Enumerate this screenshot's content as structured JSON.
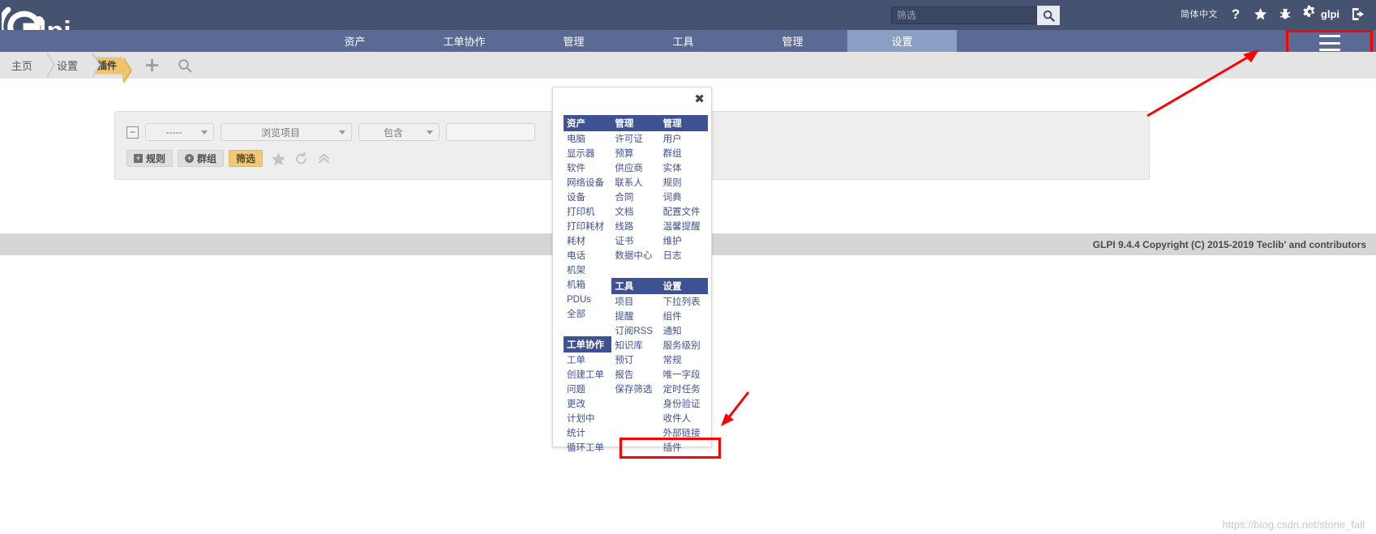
{
  "header": {
    "logo_text": "glpi",
    "search": {
      "placeholder": "筛选",
      "value": "",
      "icon": "search-icon"
    },
    "language": "简体中文",
    "help_icon": "question-mark-icon",
    "favorites_icon": "star-icon",
    "bug_icon": "bug-icon",
    "settings_icon": "gear-icon",
    "user_name": "glpi",
    "logout_icon": "logout-icon",
    "menu_toggle_icon": "hamburger-menu-icon"
  },
  "mainnav": {
    "items": [
      {
        "label": "资产",
        "active": false
      },
      {
        "label": "工单协作",
        "active": false
      },
      {
        "label": "管理",
        "active": false
      },
      {
        "label": "工具",
        "active": false
      },
      {
        "label": "管理",
        "active": false
      },
      {
        "label": "设置",
        "active": true
      }
    ]
  },
  "breadcrumb": {
    "items": [
      {
        "label": "主页",
        "selected": false
      },
      {
        "label": "设置",
        "selected": false
      },
      {
        "label": "插件",
        "selected": true
      }
    ],
    "tools": [
      {
        "name": "add-icon",
        "glyph": "+"
      },
      {
        "name": "search-icon",
        "glyph": "search"
      }
    ]
  },
  "filter_card": {
    "collapse_glyph": "−",
    "selects": [
      {
        "name": "logic-select",
        "value": "-----"
      },
      {
        "name": "field-select",
        "value": "浏览项目"
      },
      {
        "name": "operator-select",
        "value": "包含"
      }
    ],
    "text_value": "",
    "buttons": [
      {
        "name": "rule-button",
        "label": "规则",
        "icon": "plus-square-icon",
        "style": "grey"
      },
      {
        "name": "group-button",
        "label": "群组",
        "icon": "plus-circle-icon",
        "style": "grey"
      },
      {
        "name": "filter-button",
        "label": "筛选",
        "icon": "",
        "style": "amber"
      }
    ],
    "mini_tools": [
      {
        "name": "favorite-star-icon"
      },
      {
        "name": "reset-icon"
      },
      {
        "name": "collapse-chevron-icon"
      }
    ]
  },
  "footer": {
    "copyright": "GLPI 9.4.4 Copyright (C) 2015-2019 Teclib' and contributors"
  },
  "watermark": "https://blog.csdn.net/stone_fall",
  "mega_menu": {
    "close_glyph": "✖",
    "columns": [
      {
        "name": "column-assets-tickets",
        "groups": [
          {
            "header": "资产",
            "items": [
              "电脑",
              "显示器",
              "软件",
              "网络设备",
              "设备",
              "打印机",
              "打印耗材",
              "耗材",
              "电话",
              "机架",
              "机箱",
              "PDUs",
              "全部"
            ]
          },
          {
            "header": "工单协作",
            "items": [
              "工单",
              "创建工单",
              "问题",
              "更改",
              "计划中",
              "统计",
              "循环工单"
            ]
          }
        ]
      },
      {
        "name": "column-management-tools",
        "groups": [
          {
            "header": "管理",
            "items": [
              "许可证",
              "预算",
              "供应商",
              "联系人",
              "合同",
              "文档",
              "线路",
              "证书",
              "数据中心"
            ]
          },
          {
            "header": "工具",
            "items": [
              "项目",
              "提醒",
              "订阅RSS",
              "知识库",
              "预订",
              "报告",
              "保存筛选"
            ]
          }
        ]
      },
      {
        "name": "column-admin-setup",
        "groups": [
          {
            "header": "管理",
            "items": [
              "用户",
              "群组",
              "实体",
              "规则",
              "词典",
              "配置文件",
              "温馨提醒",
              "维护",
              "日志"
            ]
          },
          {
            "header": "设置",
            "items": [
              "下拉列表",
              "组件",
              "通知",
              "服务级别",
              "常规",
              "唯一字段",
              "定时任务",
              "身份验证",
              "收件人",
              "外部链接",
              "插件"
            ]
          }
        ]
      }
    ]
  },
  "annotations": {
    "highlight_color": "#ff0000",
    "highlighted_item": "插件",
    "highlighted_menu_button": "hamburger-menu-icon"
  }
}
